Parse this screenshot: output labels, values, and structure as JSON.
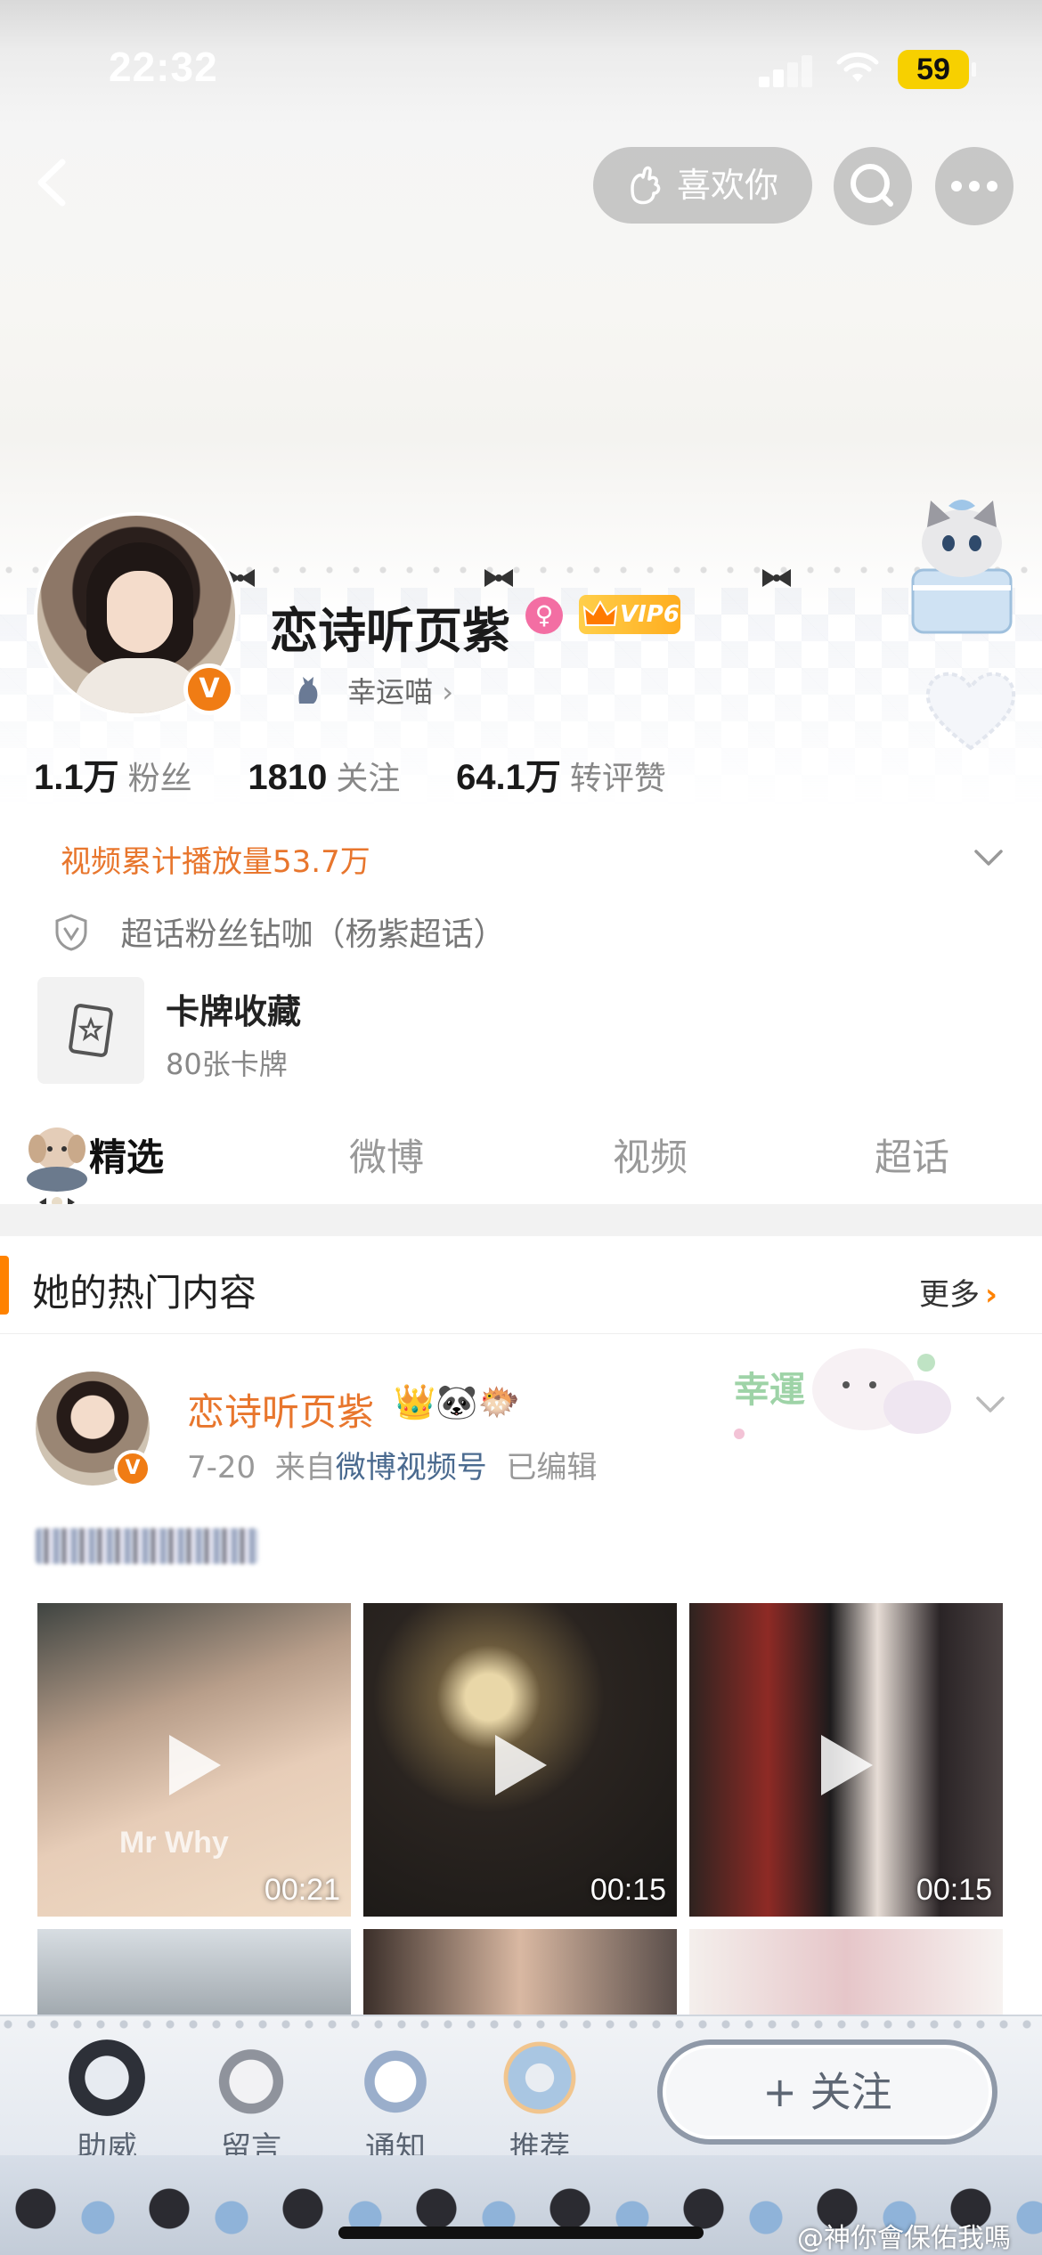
{
  "status_bar": {
    "time": "22:32",
    "battery": "59"
  },
  "header": {
    "like_button": "喜欢你"
  },
  "profile": {
    "name": "恋诗听页紫",
    "vip": "VIP6",
    "mood": "幸运喵",
    "stats": [
      {
        "num": "1.1万",
        "label": "粉丝"
      },
      {
        "num": "1810",
        "label": "关注"
      },
      {
        "num": "64.1万",
        "label": "转评赞"
      }
    ],
    "play_count": "视频累计播放量53.7万",
    "superfan": "超话粉丝钻咖（杨紫超话）",
    "card_title": "卡牌收藏",
    "card_sub": "80张卡牌"
  },
  "tabs": [
    "精选",
    "微博",
    "视频",
    "超话"
  ],
  "hot": {
    "title": "她的热门内容",
    "more": "更多"
  },
  "post": {
    "name": "恋诗听页紫",
    "badges": "👑🐼🐡",
    "date": "7-20",
    "from": "来自",
    "source": "微博视频号",
    "edited": "已编辑",
    "sticker_text": "幸運",
    "videos": [
      {
        "duration": "00:21",
        "watermark": "Mr Why"
      },
      {
        "duration": "00:15"
      },
      {
        "duration": "00:15"
      }
    ]
  },
  "bottom_bar": {
    "items": [
      "助威",
      "留言",
      "通知",
      "推荐"
    ],
    "follow": "+ 关注"
  },
  "watermark": "@神你會保佑我嗎",
  "colors": {
    "accent": "#ff8200",
    "orange_text": "#e8762d",
    "verified": "#f07c14",
    "link": "#4a6a8f"
  }
}
